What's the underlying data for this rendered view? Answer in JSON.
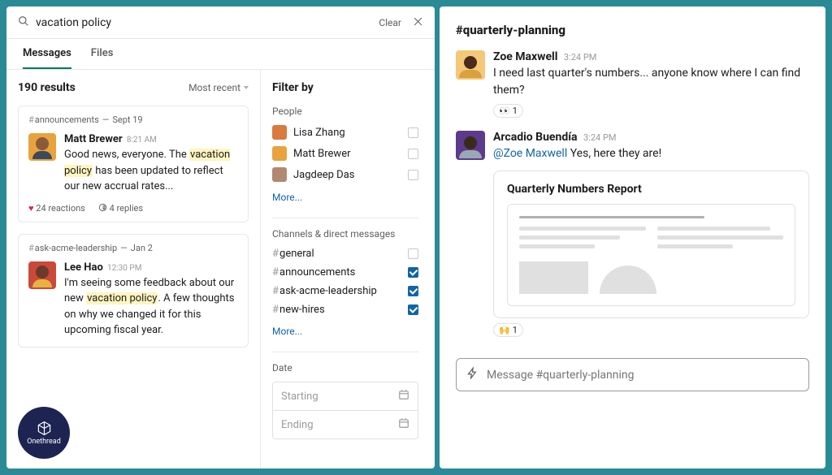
{
  "search": {
    "query": "vacation policy",
    "clear_label": "Clear"
  },
  "tabs": {
    "messages": "Messages",
    "files": "Files"
  },
  "results": {
    "count_label": "190 results",
    "sort_label": "Most recent"
  },
  "cards": [
    {
      "channel": "announcements",
      "date": "Sept 19",
      "author": "Matt Brewer",
      "time": "8:21 AM",
      "pre": "Good news, everyone. The ",
      "hl": "vacation policy",
      "post": " has been updated to reflect our new accrual rates...",
      "reactions": "24 reactions",
      "replies": "4 replies"
    },
    {
      "channel": "ask-acme-leadership",
      "date": "Jan 2",
      "author": "Lee Hao",
      "time": "12:30 PM",
      "pre": "I'm seeing some feedback about our new ",
      "hl": "vacation policy",
      "post": ". A few thoughts on why we changed it for this upcoming fiscal year."
    }
  ],
  "filter": {
    "header": "Filter by",
    "people_label": "People",
    "people": [
      "Lisa Zhang",
      "Matt Brewer",
      "Jagdeep Das"
    ],
    "more_label": "More...",
    "channels_label": "Channels & direct messages",
    "channels": [
      {
        "name": "general",
        "checked": false
      },
      {
        "name": "announcements",
        "checked": true
      },
      {
        "name": "ask-acme-leadership",
        "checked": true
      },
      {
        "name": "new-hires",
        "checked": true
      }
    ],
    "date_label": "Date",
    "starting": "Starting",
    "ending": "Ending"
  },
  "right": {
    "channel": "#quarterly-planning",
    "msg1_author": "Zoe Maxwell",
    "msg1_time": "3:24 PM",
    "msg1_text": "I need last quarter's numbers... anyone know where I can find them?",
    "msg1_reaction": "👀",
    "msg1_reaction_count": "1",
    "msg2_author": "Arcadio Buendía",
    "msg2_time": "3:24 PM",
    "msg2_mention": "@Zoe Maxwell",
    "msg2_text": " Yes, here they are!",
    "attachment_title": "Quarterly Numbers Report",
    "msg2_reaction": "🙌",
    "msg2_reaction_count": "1",
    "composer_placeholder": "Message #quarterly-planning"
  },
  "badge": {
    "label": "Onethread"
  }
}
